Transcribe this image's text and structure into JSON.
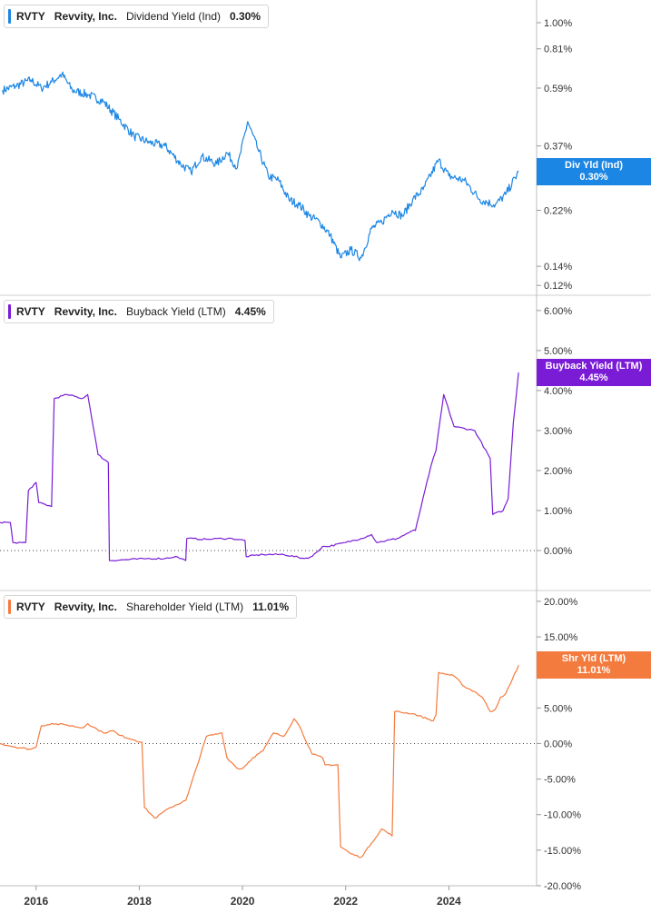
{
  "legend_ticker": "RVTY",
  "legend_company": "Revvity, Inc.",
  "x_tick_labels": [
    "2016",
    "2018",
    "2020",
    "2022",
    "2024"
  ],
  "colors": {
    "dividend": "#1c86e4",
    "buyback": "#7a1cd6",
    "shareholder": "#f47b3e"
  },
  "chart_data": [
    {
      "type": "line",
      "title": "",
      "series": [
        {
          "name": "Dividend Yield (Ind)",
          "last_value": "0.30%"
        }
      ],
      "badge": {
        "line1": "Div Yld (Ind)",
        "line2": "0.30%"
      },
      "y_scale": "log",
      "ylim": [
        0.115,
        1.1
      ],
      "y_ticks": [
        1.0,
        0.81,
        0.59,
        0.37,
        0.22,
        0.14,
        0.12
      ],
      "y_tick_labels": [
        "1.00%",
        "0.81%",
        "0.59%",
        "0.37%",
        "0.22%",
        "0.14%",
        "0.12%"
      ],
      "x": [
        2015.35,
        2015.6,
        2015.9,
        2016.1,
        2016.3,
        2016.5,
        2016.7,
        2017.0,
        2017.3,
        2017.6,
        2017.9,
        2018.2,
        2018.5,
        2018.8,
        2019.0,
        2019.2,
        2019.5,
        2019.7,
        2019.9,
        2020.1,
        2020.3,
        2020.5,
        2020.7,
        2020.9,
        2021.1,
        2021.3,
        2021.5,
        2021.7,
        2021.9,
        2022.1,
        2022.3,
        2022.5,
        2022.7,
        2022.9,
        2023.1,
        2023.3,
        2023.5,
        2023.8,
        2024.0,
        2024.3,
        2024.6,
        2024.9,
        2025.1,
        2025.35
      ],
      "values": [
        0.58,
        0.6,
        0.63,
        0.59,
        0.62,
        0.66,
        0.58,
        0.56,
        0.53,
        0.46,
        0.4,
        0.38,
        0.37,
        0.32,
        0.3,
        0.34,
        0.32,
        0.35,
        0.31,
        0.45,
        0.36,
        0.29,
        0.28,
        0.24,
        0.23,
        0.21,
        0.2,
        0.18,
        0.15,
        0.16,
        0.15,
        0.19,
        0.2,
        0.22,
        0.21,
        0.24,
        0.26,
        0.33,
        0.29,
        0.28,
        0.24,
        0.23,
        0.25,
        0.3
      ]
    },
    {
      "type": "line",
      "title": "",
      "series": [
        {
          "name": "Buyback Yield (LTM)",
          "last_value": "4.45%"
        }
      ],
      "badge": {
        "line1": "Buyback Yield (LTM)",
        "line2": "4.45%"
      },
      "ylim": [
        -0.5,
        6.2
      ],
      "y_ticks": [
        6,
        5,
        4,
        3,
        2,
        1,
        0
      ],
      "y_tick_labels": [
        "6.00%",
        "5.00%",
        "4.00%",
        "3.00%",
        "2.00%",
        "1.00%",
        "0.00%"
      ],
      "x": [
        2015.3,
        2015.5,
        2015.55,
        2015.8,
        2015.85,
        2016.0,
        2016.05,
        2016.3,
        2016.35,
        2016.6,
        2016.9,
        2017.0,
        2017.2,
        2017.4,
        2017.42,
        2018.2,
        2018.5,
        2018.7,
        2018.9,
        2018.92,
        2019.3,
        2019.6,
        2019.8,
        2020.05,
        2020.07,
        2020.4,
        2020.8,
        2021.2,
        2021.35,
        2021.55,
        2021.65,
        2022.0,
        2022.3,
        2022.5,
        2022.6,
        2023.0,
        2023.3,
        2023.35,
        2023.65,
        2023.75,
        2023.9,
        2024.1,
        2024.5,
        2024.8,
        2024.85,
        2025.05,
        2025.15,
        2025.25,
        2025.35
      ],
      "values": [
        0.7,
        0.7,
        0.2,
        0.2,
        1.5,
        1.7,
        1.2,
        1.1,
        3.8,
        3.9,
        3.8,
        3.9,
        2.4,
        2.2,
        -0.25,
        -0.2,
        -0.2,
        -0.15,
        -0.25,
        0.3,
        0.28,
        0.3,
        0.3,
        0.25,
        -0.15,
        -0.1,
        -0.1,
        -0.2,
        -0.15,
        0.1,
        0.1,
        0.2,
        0.3,
        0.4,
        0.2,
        0.3,
        0.5,
        0.5,
        2.1,
        2.5,
        3.9,
        3.1,
        3.0,
        2.3,
        0.9,
        1.0,
        1.3,
        3.2,
        4.45
      ]
    },
    {
      "type": "line",
      "title": "",
      "series": [
        {
          "name": "Shareholder Yield (LTM)",
          "last_value": "11.01%"
        }
      ],
      "badge": {
        "line1": "Shr Yld (LTM)",
        "line2": "11.01%"
      },
      "ylim": [
        -20,
        20.5
      ],
      "y_ticks": [
        20,
        15,
        10,
        5,
        0,
        -5,
        -10,
        -15,
        -20
      ],
      "y_tick_labels": [
        "20.00%",
        "15.00%",
        "10.00%",
        "5.00%",
        "0.00%",
        "-5.00%",
        "-10.00%",
        "-15.00%",
        "-20.00%"
      ],
      "x": [
        2015.3,
        2015.6,
        2015.9,
        2016.0,
        2016.1,
        2016.3,
        2016.6,
        2016.9,
        2017.0,
        2017.3,
        2017.5,
        2017.6,
        2017.9,
        2018.05,
        2018.1,
        2018.3,
        2018.6,
        2018.9,
        2018.95,
        2019.3,
        2019.6,
        2019.7,
        2019.9,
        2020.0,
        2020.2,
        2020.4,
        2020.6,
        2020.8,
        2021.0,
        2021.1,
        2021.35,
        2021.55,
        2021.6,
        2021.85,
        2021.9,
        2022.1,
        2022.3,
        2022.5,
        2022.7,
        2022.9,
        2022.95,
        2023.3,
        2023.7,
        2023.75,
        2023.8,
        2024.1,
        2024.3,
        2024.5,
        2024.65,
        2024.8,
        2024.9,
        2025.0,
        2025.1,
        2025.2,
        2025.35
      ],
      "values": [
        0,
        -0.5,
        -0.8,
        -0.5,
        2.5,
        2.8,
        2.6,
        2.2,
        2.8,
        1.5,
        1.8,
        1.2,
        0.5,
        0.2,
        -9,
        -10.5,
        -9,
        -8,
        -7,
        1,
        1.5,
        -2,
        -3.5,
        -3.5,
        -2,
        -1,
        1.5,
        1,
        3.5,
        2.5,
        -1.5,
        -2,
        -3,
        -3,
        -14.5,
        -15.5,
        -16,
        -14,
        -12,
        -13,
        4.5,
        4.2,
        3.2,
        4,
        10,
        9.5,
        8,
        7.3,
        6.5,
        4.5,
        4.8,
        6.5,
        7,
        8.5,
        11.01
      ]
    }
  ]
}
